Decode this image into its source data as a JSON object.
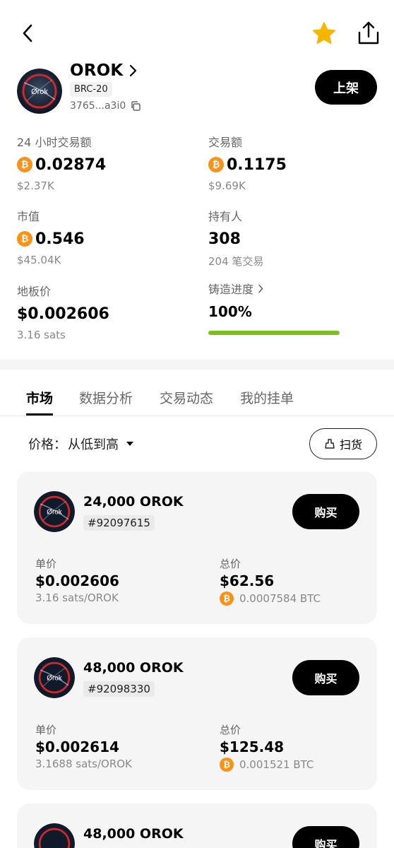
{
  "header": {
    "token_name": "OROK",
    "tag": "BRC-20",
    "address": "3765...a3i0",
    "list_button": "上架",
    "avatar_text": "Ørok"
  },
  "stats": {
    "volume_24h": {
      "label": "24 小时交易额",
      "value": "0.02874",
      "usd": "$2.37K"
    },
    "volume_total": {
      "label": "交易额",
      "value": "0.1175",
      "usd": "$9.69K"
    },
    "market_cap": {
      "label": "市值",
      "value": "0.546",
      "usd": "$45.04K"
    },
    "holders": {
      "label": "持有人",
      "value": "308",
      "sub": "204 笔交易"
    },
    "floor_price": {
      "label": "地板价",
      "value": "$0.002606",
      "sub": "3.16 sats"
    },
    "mint_progress": {
      "label": "铸造进度",
      "value": "100%",
      "fraction": 1.0
    }
  },
  "tabs": [
    "市场",
    "数据分析",
    "交易动态",
    "我的挂单"
  ],
  "sort": {
    "label": "价格：",
    "value": "从低到高"
  },
  "sweep_button": "扫货",
  "listings": [
    {
      "amount": "24,000 OROK",
      "id": "#92097615",
      "buy": "购买",
      "unit_label": "单价",
      "unit_price": "$0.002606",
      "unit_sats": "3.16 sats/OROK",
      "total_label": "总价",
      "total_price": "$62.56",
      "total_btc": "0.0007584 BTC"
    },
    {
      "amount": "48,000 OROK",
      "id": "#92098330",
      "buy": "购买",
      "unit_label": "单价",
      "unit_price": "$0.002614",
      "unit_sats": "3.1688 sats/OROK",
      "total_label": "总价",
      "total_price": "$125.48",
      "total_btc": "0.001521 BTC"
    },
    {
      "amount": "48,000 OROK",
      "buy": "购买"
    }
  ],
  "colors": {
    "btc": "#f7931a",
    "progress": "#7dbf1d",
    "star": "#f6b500"
  },
  "icons": {
    "btc": "₿"
  }
}
